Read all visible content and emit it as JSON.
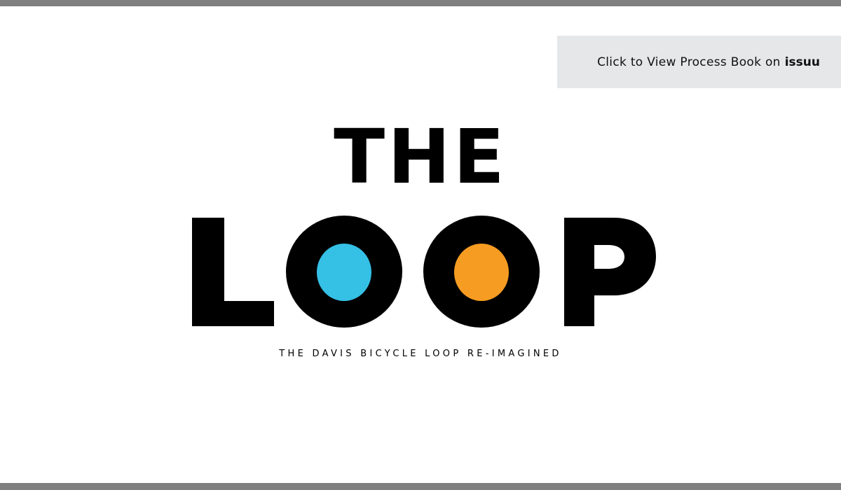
{
  "colors": {
    "frame_bar": "#808080",
    "button_bg": "#e6e7e8",
    "logo_ink": "#000000",
    "dot_left": "#35c0e6",
    "dot_right": "#f79c22"
  },
  "cta": {
    "label": "Click to View Process Book on",
    "brand": "issuu"
  },
  "logo": {
    "line1": "THE",
    "line2": "LOOP",
    "tagline": "THE DAVIS BICYCLE LOOP RE-IMAGINED"
  }
}
